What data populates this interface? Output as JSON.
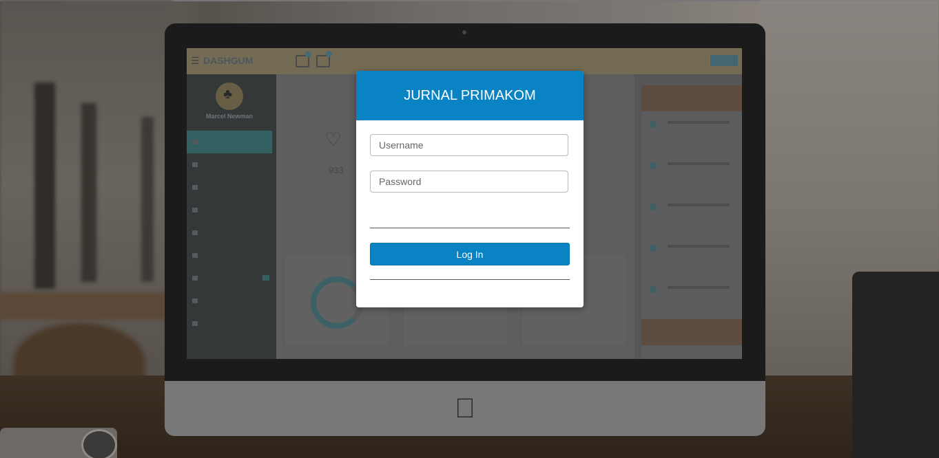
{
  "login": {
    "title": "JURNAL PRIMAKOM",
    "username_placeholder": "Username",
    "password_placeholder": "Password",
    "username_value": "",
    "password_value": "",
    "submit_label": "Log In"
  },
  "colors": {
    "accent": "#0a83c4",
    "modal_bg": "#ffffff"
  },
  "background_dashboard": {
    "brand": "DASHGUM",
    "user_name": "Marcel Newman",
    "stat_value": "933"
  }
}
